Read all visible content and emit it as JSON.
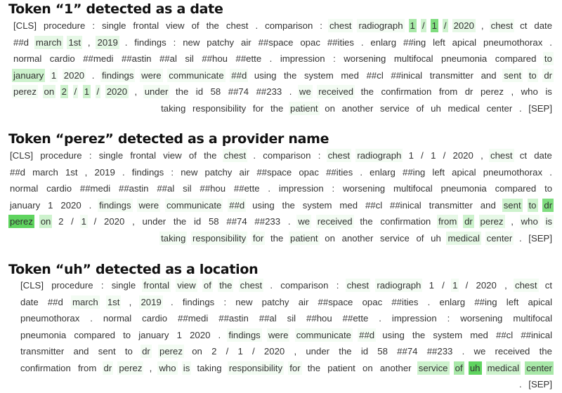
{
  "colors": {
    "text": "#333333",
    "title": "#111111",
    "h0": "transparent",
    "h1": "#f3fcf3",
    "h2": "#e6f8e6",
    "h3": "#cdf2cd",
    "h4": "#a8e8a8",
    "h5": "#7fdd7f",
    "h6": "#5fd45f"
  },
  "panels": [
    {
      "title": "Token “1” detected as a date",
      "tokens": [
        [
          "[CLS]",
          0
        ],
        [
          "procedure",
          0
        ],
        [
          ":",
          0
        ],
        [
          "single",
          0
        ],
        [
          "frontal",
          0
        ],
        [
          "view",
          0
        ],
        [
          "of",
          0
        ],
        [
          "the",
          0
        ],
        [
          "chest",
          0
        ],
        [
          ".",
          0
        ],
        [
          "comparison",
          0
        ],
        [
          ":",
          0
        ],
        [
          "chest",
          1
        ],
        [
          "radiograph",
          1
        ],
        [
          "1",
          4
        ],
        [
          "/",
          3
        ],
        [
          "1",
          5
        ],
        [
          "/",
          3
        ],
        [
          "2020",
          2
        ],
        [
          ",",
          0
        ],
        [
          "chest",
          1
        ],
        [
          "ct",
          0
        ],
        [
          "date",
          0
        ],
        [
          "##d",
          0
        ],
        [
          "march",
          2
        ],
        [
          "1st",
          2
        ],
        [
          ",",
          0
        ],
        [
          "2019",
          2
        ],
        [
          ".",
          0
        ],
        [
          "findings",
          0
        ],
        [
          ":",
          0
        ],
        [
          "new",
          0
        ],
        [
          "patchy",
          0
        ],
        [
          "air",
          0
        ],
        [
          "##space",
          0
        ],
        [
          "opac",
          0
        ],
        [
          "##ities",
          0
        ],
        [
          ".",
          0
        ],
        [
          "enlarg",
          0
        ],
        [
          "##ing",
          0
        ],
        [
          "left",
          0
        ],
        [
          "apical",
          0
        ],
        [
          "pneumothorax",
          0
        ],
        [
          ".",
          0
        ],
        [
          "normal",
          0
        ],
        [
          "cardio",
          0
        ],
        [
          "##medi",
          0
        ],
        [
          "##astin",
          0
        ],
        [
          "##al",
          0
        ],
        [
          "sil",
          0
        ],
        [
          "##hou",
          0
        ],
        [
          "##ette",
          0
        ],
        [
          ".",
          0
        ],
        [
          "impression",
          0
        ],
        [
          ":",
          0
        ],
        [
          "worsening",
          0
        ],
        [
          "multifocal",
          0
        ],
        [
          "pneumonia",
          0
        ],
        [
          "compared",
          0
        ],
        [
          "to",
          1
        ],
        [
          "january",
          3
        ],
        [
          "1",
          1
        ],
        [
          "2020",
          1
        ],
        [
          ".",
          0
        ],
        [
          "findings",
          1
        ],
        [
          "were",
          1
        ],
        [
          "communicate",
          1
        ],
        [
          "##d",
          1
        ],
        [
          "using",
          0
        ],
        [
          "the",
          0
        ],
        [
          "system",
          0
        ],
        [
          "med",
          0
        ],
        [
          "##cl",
          0
        ],
        [
          "##inical",
          0
        ],
        [
          "transmitter",
          0
        ],
        [
          "and",
          0
        ],
        [
          "sent",
          1
        ],
        [
          "to",
          1
        ],
        [
          "dr",
          1
        ],
        [
          "perez",
          1
        ],
        [
          "on",
          2
        ],
        [
          "2",
          3
        ],
        [
          "/",
          2
        ],
        [
          "1",
          3
        ],
        [
          "/",
          2
        ],
        [
          "2020",
          2
        ],
        [
          ",",
          0
        ],
        [
          "under",
          1
        ],
        [
          "the",
          0
        ],
        [
          "id",
          0
        ],
        [
          "58",
          0
        ],
        [
          "##74",
          0
        ],
        [
          "##233",
          0
        ],
        [
          ".",
          0
        ],
        [
          "we",
          1
        ],
        [
          "received",
          1
        ],
        [
          "the",
          0
        ],
        [
          "confirmation",
          0
        ],
        [
          "from",
          0
        ],
        [
          "dr",
          0
        ],
        [
          "perez",
          0
        ],
        [
          ",",
          0
        ],
        [
          "who",
          0
        ],
        [
          "is",
          0
        ],
        [
          "taking",
          0
        ],
        [
          "responsibility",
          0
        ],
        [
          "for",
          0
        ],
        [
          "the",
          0
        ],
        [
          "patient",
          1
        ],
        [
          "on",
          0
        ],
        [
          "another",
          0
        ],
        [
          "service",
          0
        ],
        [
          "of",
          0
        ],
        [
          "uh",
          0
        ],
        [
          "medical",
          0
        ],
        [
          "center",
          0
        ],
        [
          ".",
          0
        ],
        [
          "[SEP]",
          0
        ]
      ]
    },
    {
      "title": "Token “perez” detected as a provider name",
      "tokens": [
        [
          "[CLS]",
          0
        ],
        [
          "procedure",
          0
        ],
        [
          ":",
          0
        ],
        [
          "single",
          0
        ],
        [
          "frontal",
          0
        ],
        [
          "view",
          0
        ],
        [
          "of",
          0
        ],
        [
          "the",
          0
        ],
        [
          "chest",
          1
        ],
        [
          ".",
          0
        ],
        [
          "comparison",
          0
        ],
        [
          ":",
          0
        ],
        [
          "chest",
          1
        ],
        [
          "radiograph",
          1
        ],
        [
          "1",
          0
        ],
        [
          "/",
          0
        ],
        [
          "1",
          0
        ],
        [
          "/",
          0
        ],
        [
          "2020",
          0
        ],
        [
          ",",
          0
        ],
        [
          "chest",
          1
        ],
        [
          "ct",
          0
        ],
        [
          "date",
          0
        ],
        [
          "##d",
          0
        ],
        [
          "march",
          0
        ],
        [
          "1st",
          0
        ],
        [
          ",",
          0
        ],
        [
          "2019",
          0
        ],
        [
          ".",
          0
        ],
        [
          "findings",
          0
        ],
        [
          ":",
          0
        ],
        [
          "new",
          0
        ],
        [
          "patchy",
          0
        ],
        [
          "air",
          0
        ],
        [
          "##space",
          0
        ],
        [
          "opac",
          0
        ],
        [
          "##ities",
          0
        ],
        [
          ".",
          0
        ],
        [
          "enlarg",
          0
        ],
        [
          "##ing",
          0
        ],
        [
          "left",
          0
        ],
        [
          "apical",
          0
        ],
        [
          "pneumothorax",
          0
        ],
        [
          ".",
          0
        ],
        [
          "normal",
          0
        ],
        [
          "cardio",
          0
        ],
        [
          "##medi",
          0
        ],
        [
          "##astin",
          0
        ],
        [
          "##al",
          0
        ],
        [
          "sil",
          0
        ],
        [
          "##hou",
          0
        ],
        [
          "##ette",
          0
        ],
        [
          ".",
          0
        ],
        [
          "impression",
          0
        ],
        [
          ":",
          0
        ],
        [
          "worsening",
          0
        ],
        [
          "multifocal",
          0
        ],
        [
          "pneumonia",
          0
        ],
        [
          "compared",
          0
        ],
        [
          "to",
          0
        ],
        [
          "january",
          0
        ],
        [
          "1",
          0
        ],
        [
          "2020",
          0
        ],
        [
          ".",
          0
        ],
        [
          "findings",
          1
        ],
        [
          "were",
          1
        ],
        [
          "communicate",
          1
        ],
        [
          "##d",
          1
        ],
        [
          "using",
          0
        ],
        [
          "the",
          0
        ],
        [
          "system",
          0
        ],
        [
          "med",
          0
        ],
        [
          "##cl",
          0
        ],
        [
          "##inical",
          0
        ],
        [
          "transmitter",
          0
        ],
        [
          "and",
          0
        ],
        [
          "sent",
          3
        ],
        [
          "to",
          3
        ],
        [
          "dr",
          5
        ],
        [
          "perez",
          6
        ],
        [
          "on",
          3
        ],
        [
          "2",
          0
        ],
        [
          "/",
          0
        ],
        [
          "1",
          1
        ],
        [
          "/",
          0
        ],
        [
          "2020",
          0
        ],
        [
          ",",
          0
        ],
        [
          "under",
          0
        ],
        [
          "the",
          0
        ],
        [
          "id",
          0
        ],
        [
          "58",
          0
        ],
        [
          "##74",
          0
        ],
        [
          "##233",
          0
        ],
        [
          ".",
          0
        ],
        [
          "we",
          1
        ],
        [
          "received",
          1
        ],
        [
          "the",
          0
        ],
        [
          "confirmation",
          0
        ],
        [
          "from",
          2
        ],
        [
          "dr",
          3
        ],
        [
          "perez",
          2
        ],
        [
          ",",
          0
        ],
        [
          "who",
          1
        ],
        [
          "is",
          1
        ],
        [
          "taking",
          1
        ],
        [
          "responsibility",
          1
        ],
        [
          "for",
          1
        ],
        [
          "the",
          0
        ],
        [
          "patient",
          1
        ],
        [
          "on",
          0
        ],
        [
          "another",
          0
        ],
        [
          "service",
          0
        ],
        [
          "of",
          0
        ],
        [
          "uh",
          0
        ],
        [
          "medical",
          2
        ],
        [
          "center",
          1
        ],
        [
          ".",
          0
        ],
        [
          "[SEP]",
          0
        ]
      ]
    },
    {
      "title": "Token “uh” detected as a location",
      "tokens": [
        [
          "[CLS]",
          0
        ],
        [
          "procedure",
          0
        ],
        [
          ":",
          0
        ],
        [
          "single",
          0
        ],
        [
          "frontal",
          1
        ],
        [
          "view",
          1
        ],
        [
          "of",
          1
        ],
        [
          "the",
          1
        ],
        [
          "chest",
          1
        ],
        [
          ".",
          0
        ],
        [
          "comparison",
          0
        ],
        [
          ":",
          0
        ],
        [
          "chest",
          1
        ],
        [
          "radiograph",
          1
        ],
        [
          "1",
          0
        ],
        [
          "/",
          0
        ],
        [
          "1",
          1
        ],
        [
          "/",
          0
        ],
        [
          "2020",
          0
        ],
        [
          ",",
          0
        ],
        [
          "chest",
          1
        ],
        [
          "ct",
          0
        ],
        [
          "date",
          0
        ],
        [
          "##d",
          0
        ],
        [
          "march",
          1
        ],
        [
          "1st",
          1
        ],
        [
          ",",
          0
        ],
        [
          "2019",
          1
        ],
        [
          ".",
          0
        ],
        [
          "findings",
          0
        ],
        [
          ":",
          0
        ],
        [
          "new",
          0
        ],
        [
          "patchy",
          0
        ],
        [
          "air",
          0
        ],
        [
          "##space",
          0
        ],
        [
          "opac",
          0
        ],
        [
          "##ities",
          0
        ],
        [
          ".",
          0
        ],
        [
          "enlarg",
          0
        ],
        [
          "##ing",
          0
        ],
        [
          "left",
          0
        ],
        [
          "apical",
          0
        ],
        [
          "pneumothorax",
          0
        ],
        [
          ".",
          0
        ],
        [
          "normal",
          0
        ],
        [
          "cardio",
          0
        ],
        [
          "##medi",
          0
        ],
        [
          "##astin",
          0
        ],
        [
          "##al",
          0
        ],
        [
          "sil",
          0
        ],
        [
          "##hou",
          0
        ],
        [
          "##ette",
          0
        ],
        [
          ".",
          0
        ],
        [
          "impression",
          0
        ],
        [
          ":",
          0
        ],
        [
          "worsening",
          0
        ],
        [
          "multifocal",
          0
        ],
        [
          "pneumonia",
          0
        ],
        [
          "compared",
          0
        ],
        [
          "to",
          0
        ],
        [
          "january",
          0
        ],
        [
          "1",
          0
        ],
        [
          "2020",
          0
        ],
        [
          ".",
          0
        ],
        [
          "findings",
          1
        ],
        [
          "were",
          1
        ],
        [
          "communicate",
          1
        ],
        [
          "##d",
          1
        ],
        [
          "using",
          0
        ],
        [
          "the",
          0
        ],
        [
          "system",
          0
        ],
        [
          "med",
          0
        ],
        [
          "##cl",
          0
        ],
        [
          "##inical",
          0
        ],
        [
          "transmitter",
          0
        ],
        [
          "and",
          0
        ],
        [
          "sent",
          0
        ],
        [
          "to",
          0
        ],
        [
          "dr",
          1
        ],
        [
          "perez",
          1
        ],
        [
          "on",
          0
        ],
        [
          "2",
          0
        ],
        [
          "/",
          0
        ],
        [
          "1",
          0
        ],
        [
          "/",
          0
        ],
        [
          "2020",
          0
        ],
        [
          ",",
          0
        ],
        [
          "under",
          0
        ],
        [
          "the",
          0
        ],
        [
          "id",
          0
        ],
        [
          "58",
          0
        ],
        [
          "##74",
          0
        ],
        [
          "##233",
          0
        ],
        [
          ".",
          0
        ],
        [
          "we",
          0
        ],
        [
          "received",
          0
        ],
        [
          "the",
          0
        ],
        [
          "confirmation",
          0
        ],
        [
          "from",
          0
        ],
        [
          "dr",
          1
        ],
        [
          "perez",
          1
        ],
        [
          ",",
          0
        ],
        [
          "who",
          1
        ],
        [
          "is",
          1
        ],
        [
          "taking",
          0
        ],
        [
          "responsibility",
          1
        ],
        [
          "for",
          1
        ],
        [
          "the",
          0
        ],
        [
          "patient",
          0
        ],
        [
          "on",
          0
        ],
        [
          "another",
          0
        ],
        [
          "service",
          3
        ],
        [
          "of",
          4
        ],
        [
          "uh",
          6
        ],
        [
          "medical",
          3
        ],
        [
          "center",
          4
        ],
        [
          ".",
          0
        ],
        [
          "[SEP]",
          0
        ]
      ]
    }
  ]
}
